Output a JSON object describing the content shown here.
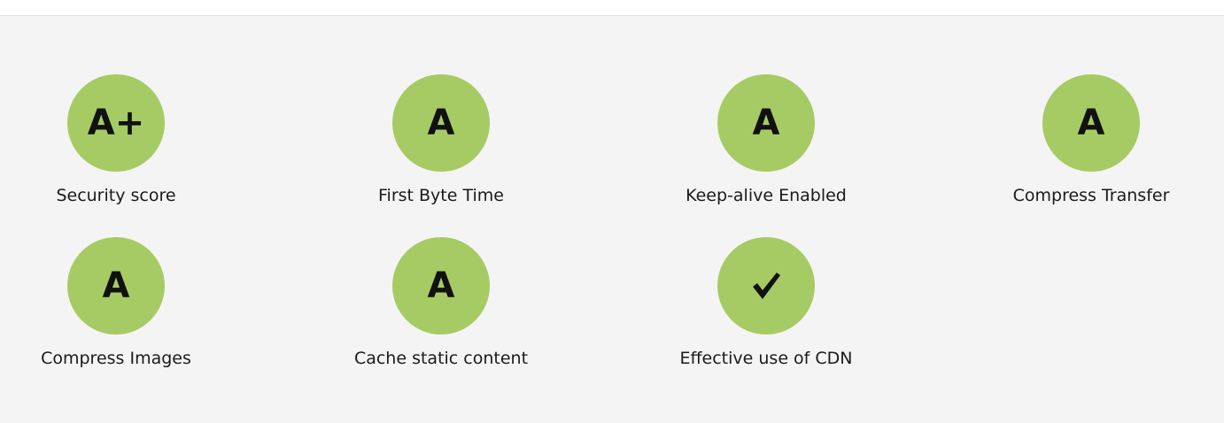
{
  "grades": [
    {
      "grade": "A+",
      "label": "Security score"
    },
    {
      "grade": "A",
      "label": "First Byte Time"
    },
    {
      "grade": "A",
      "label": "Keep-alive Enabled"
    },
    {
      "grade": "A",
      "label": "Compress Transfer"
    },
    {
      "grade": "A",
      "label": "Compress Images"
    },
    {
      "grade": "A",
      "label": "Cache static content"
    },
    {
      "grade_icon": "checkmark-icon",
      "label": "Effective use of CDN"
    }
  ],
  "colors": {
    "grade_fill": "#a6cb64",
    "panel_background": "#f4f4f4",
    "text": "#1a1a1a"
  }
}
